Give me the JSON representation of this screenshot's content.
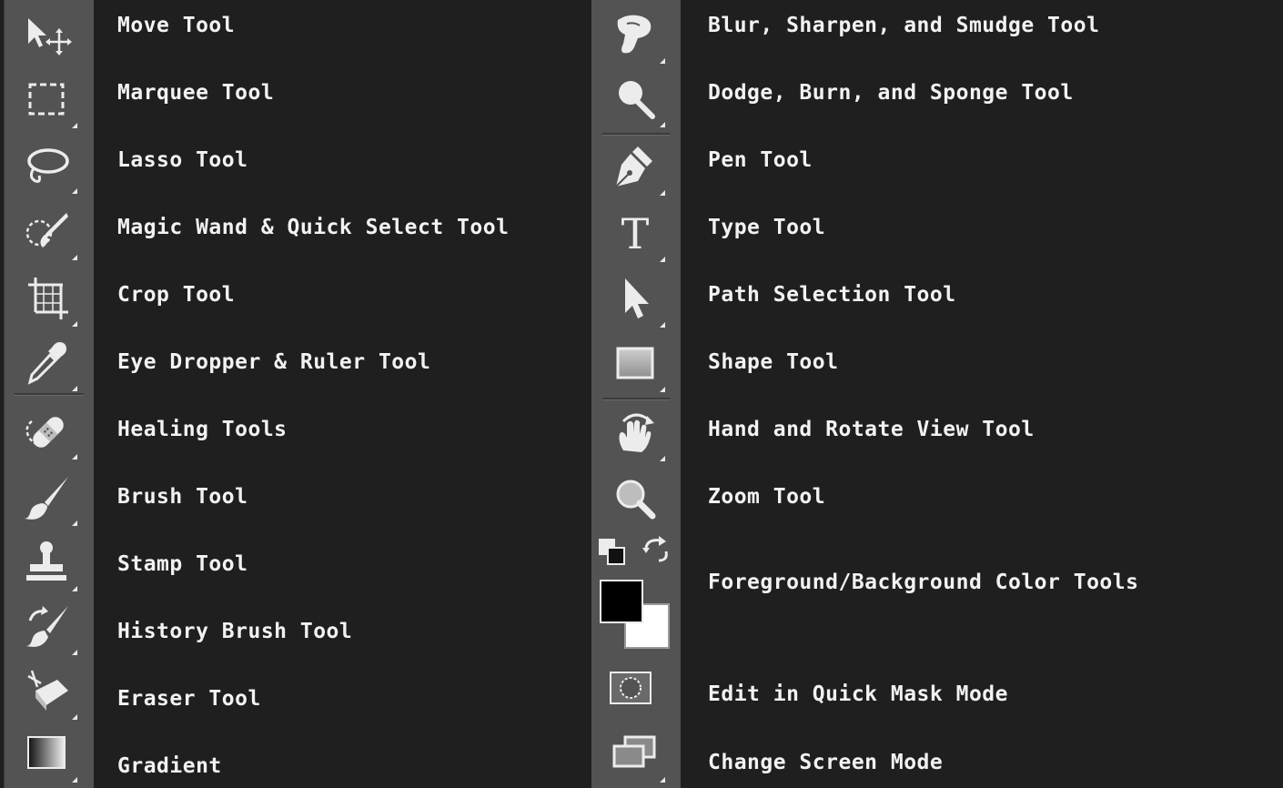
{
  "left_tools": [
    {
      "icon": "move-icon",
      "label": "Move Tool"
    },
    {
      "icon": "marquee-icon",
      "label": "Marquee Tool"
    },
    {
      "icon": "lasso-icon",
      "label": "Lasso Tool"
    },
    {
      "icon": "magic-wand-icon",
      "label": "Magic Wand & Quick Select Tool"
    },
    {
      "icon": "crop-icon",
      "label": "Crop Tool"
    },
    {
      "icon": "eyedropper-icon",
      "label": "Eye Dropper & Ruler Tool"
    },
    {
      "icon": "healing-icon",
      "label": "Healing Tools"
    },
    {
      "icon": "brush-icon",
      "label": "Brush Tool"
    },
    {
      "icon": "stamp-icon",
      "label": "Stamp Tool"
    },
    {
      "icon": "history-brush-icon",
      "label": "History Brush Tool"
    },
    {
      "icon": "eraser-icon",
      "label": "Eraser Tool"
    },
    {
      "icon": "gradient-icon",
      "label": "Gradient"
    }
  ],
  "right_tools": [
    {
      "icon": "smudge-icon",
      "label": "Blur, Sharpen, and Smudge Tool"
    },
    {
      "icon": "dodge-icon",
      "label": "Dodge, Burn, and Sponge Tool"
    },
    {
      "icon": "pen-icon",
      "label": "Pen Tool"
    },
    {
      "icon": "type-icon",
      "label": "Type Tool",
      "glyph": "T"
    },
    {
      "icon": "path-selection-icon",
      "label": "Path Selection Tool"
    },
    {
      "icon": "shape-icon",
      "label": "Shape Tool"
    },
    {
      "icon": "hand-rotate-icon",
      "label": "Hand and Rotate View Tool"
    },
    {
      "icon": "zoom-icon",
      "label": "Zoom Tool"
    },
    {
      "icon": "color-swatches-icon",
      "label": "Foreground/Background Color Tools"
    },
    {
      "icon": "quick-mask-icon",
      "label": "Edit in Quick Mask Mode"
    },
    {
      "icon": "screen-mode-icon",
      "label": "Change Screen Mode"
    }
  ],
  "colors": {
    "panel": "#535353",
    "background": "#1f1f1f",
    "text": "#f2f2f2",
    "foreground_swatch": "#000000",
    "background_swatch": "#ffffff"
  }
}
